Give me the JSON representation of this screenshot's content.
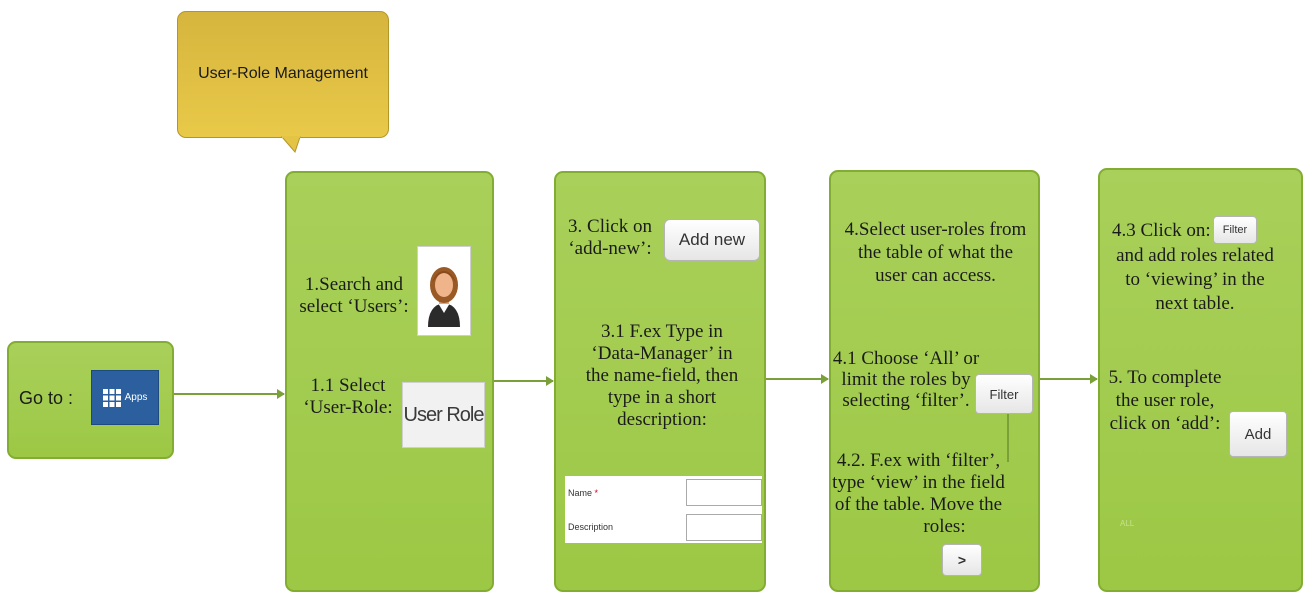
{
  "callout": {
    "title": "User-Role Management"
  },
  "goto": {
    "label": "Go to :",
    "apps_button": "Apps"
  },
  "step1": {
    "line1": "1.Search and",
    "line2": "select ‘Users’:",
    "line3": "1.1 Select",
    "line4": "‘User-Role:",
    "user_role_button": "User Role"
  },
  "step3": {
    "line1": "3. Click on",
    "line2": "‘add-new’:",
    "add_new_button": "Add new",
    "desc1": "3.1 F.ex Type in",
    "desc2": "‘Data-Manager’ in",
    "desc3": "the name-field, then",
    "desc4": "type in a short",
    "desc5": "description:",
    "form_name_label": "Name",
    "form_required_mark": "*",
    "form_description_label": "Description"
  },
  "step4": {
    "line1": "4.Select user-roles from",
    "line2": "the table of what the",
    "line3": "user can access.",
    "line4": "4.1 Choose ‘All’ or",
    "line5": "limit the roles by",
    "line6": "selecting ‘filter’.",
    "filter_button": "Filter",
    "line7": "4.2. F.ex with ‘filter’,",
    "line8": "type ‘view’ in the field",
    "line9": "of the table. Move the",
    "line10": "roles:",
    "move_button": ">"
  },
  "step5": {
    "line1": "4.3 Click on:",
    "filter_button": "Filter",
    "line2": "and add roles related",
    "line3": "to ‘viewing’ in the",
    "line4": "next table.",
    "line5": "5. To complete",
    "line6": "the user role,",
    "line7": "click on ‘add’:",
    "add_button": "Add",
    "faint_label": "ALL"
  },
  "colors": {
    "box_green": "#a4cc50",
    "callout_gold": "#e0bf45",
    "apps_blue": "#2b5f9e"
  },
  "icons": {
    "apps": "grid-icon",
    "users": "user-avatar-icon"
  }
}
